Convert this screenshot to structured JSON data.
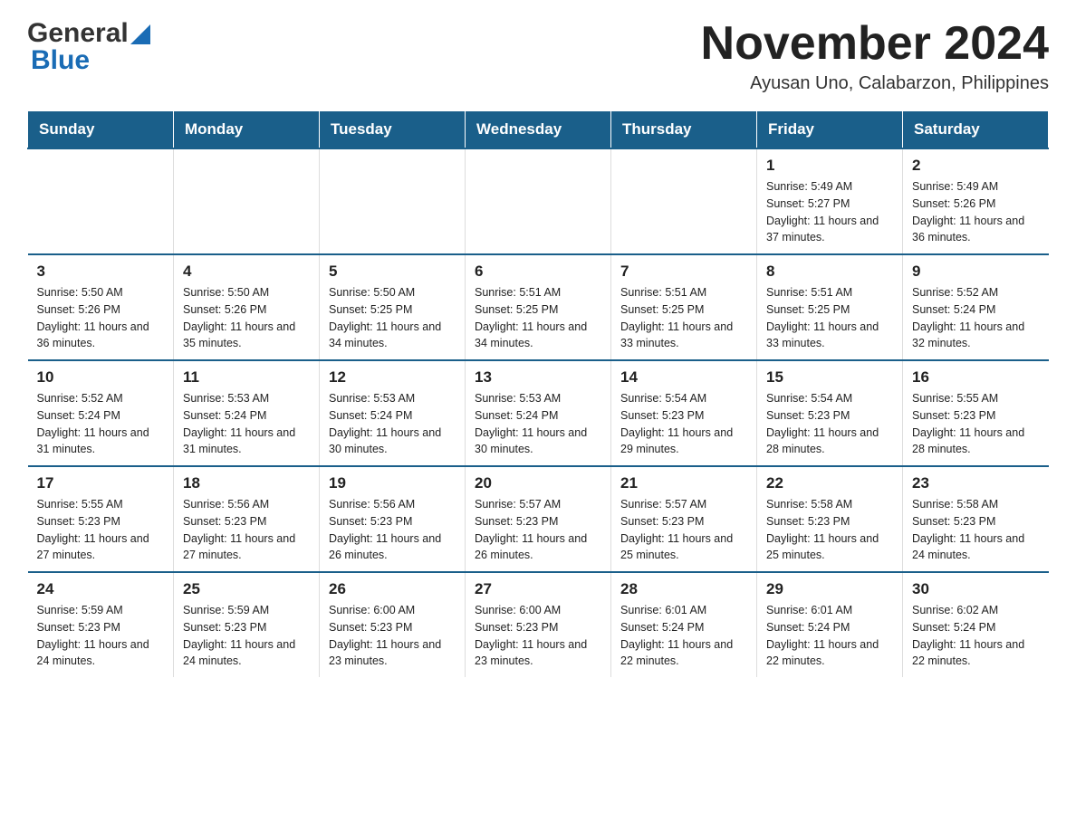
{
  "header": {
    "logo_general": "General",
    "logo_blue": "Blue",
    "main_title": "November 2024",
    "subtitle": "Ayusan Uno, Calabarzon, Philippines"
  },
  "calendar": {
    "days_of_week": [
      "Sunday",
      "Monday",
      "Tuesday",
      "Wednesday",
      "Thursday",
      "Friday",
      "Saturday"
    ],
    "weeks": [
      [
        {
          "day": "",
          "info": ""
        },
        {
          "day": "",
          "info": ""
        },
        {
          "day": "",
          "info": ""
        },
        {
          "day": "",
          "info": ""
        },
        {
          "day": "",
          "info": ""
        },
        {
          "day": "1",
          "info": "Sunrise: 5:49 AM\nSunset: 5:27 PM\nDaylight: 11 hours and 37 minutes."
        },
        {
          "day": "2",
          "info": "Sunrise: 5:49 AM\nSunset: 5:26 PM\nDaylight: 11 hours and 36 minutes."
        }
      ],
      [
        {
          "day": "3",
          "info": "Sunrise: 5:50 AM\nSunset: 5:26 PM\nDaylight: 11 hours and 36 minutes."
        },
        {
          "day": "4",
          "info": "Sunrise: 5:50 AM\nSunset: 5:26 PM\nDaylight: 11 hours and 35 minutes."
        },
        {
          "day": "5",
          "info": "Sunrise: 5:50 AM\nSunset: 5:25 PM\nDaylight: 11 hours and 34 minutes."
        },
        {
          "day": "6",
          "info": "Sunrise: 5:51 AM\nSunset: 5:25 PM\nDaylight: 11 hours and 34 minutes."
        },
        {
          "day": "7",
          "info": "Sunrise: 5:51 AM\nSunset: 5:25 PM\nDaylight: 11 hours and 33 minutes."
        },
        {
          "day": "8",
          "info": "Sunrise: 5:51 AM\nSunset: 5:25 PM\nDaylight: 11 hours and 33 minutes."
        },
        {
          "day": "9",
          "info": "Sunrise: 5:52 AM\nSunset: 5:24 PM\nDaylight: 11 hours and 32 minutes."
        }
      ],
      [
        {
          "day": "10",
          "info": "Sunrise: 5:52 AM\nSunset: 5:24 PM\nDaylight: 11 hours and 31 minutes."
        },
        {
          "day": "11",
          "info": "Sunrise: 5:53 AM\nSunset: 5:24 PM\nDaylight: 11 hours and 31 minutes."
        },
        {
          "day": "12",
          "info": "Sunrise: 5:53 AM\nSunset: 5:24 PM\nDaylight: 11 hours and 30 minutes."
        },
        {
          "day": "13",
          "info": "Sunrise: 5:53 AM\nSunset: 5:24 PM\nDaylight: 11 hours and 30 minutes."
        },
        {
          "day": "14",
          "info": "Sunrise: 5:54 AM\nSunset: 5:23 PM\nDaylight: 11 hours and 29 minutes."
        },
        {
          "day": "15",
          "info": "Sunrise: 5:54 AM\nSunset: 5:23 PM\nDaylight: 11 hours and 28 minutes."
        },
        {
          "day": "16",
          "info": "Sunrise: 5:55 AM\nSunset: 5:23 PM\nDaylight: 11 hours and 28 minutes."
        }
      ],
      [
        {
          "day": "17",
          "info": "Sunrise: 5:55 AM\nSunset: 5:23 PM\nDaylight: 11 hours and 27 minutes."
        },
        {
          "day": "18",
          "info": "Sunrise: 5:56 AM\nSunset: 5:23 PM\nDaylight: 11 hours and 27 minutes."
        },
        {
          "day": "19",
          "info": "Sunrise: 5:56 AM\nSunset: 5:23 PM\nDaylight: 11 hours and 26 minutes."
        },
        {
          "day": "20",
          "info": "Sunrise: 5:57 AM\nSunset: 5:23 PM\nDaylight: 11 hours and 26 minutes."
        },
        {
          "day": "21",
          "info": "Sunrise: 5:57 AM\nSunset: 5:23 PM\nDaylight: 11 hours and 25 minutes."
        },
        {
          "day": "22",
          "info": "Sunrise: 5:58 AM\nSunset: 5:23 PM\nDaylight: 11 hours and 25 minutes."
        },
        {
          "day": "23",
          "info": "Sunrise: 5:58 AM\nSunset: 5:23 PM\nDaylight: 11 hours and 24 minutes."
        }
      ],
      [
        {
          "day": "24",
          "info": "Sunrise: 5:59 AM\nSunset: 5:23 PM\nDaylight: 11 hours and 24 minutes."
        },
        {
          "day": "25",
          "info": "Sunrise: 5:59 AM\nSunset: 5:23 PM\nDaylight: 11 hours and 24 minutes."
        },
        {
          "day": "26",
          "info": "Sunrise: 6:00 AM\nSunset: 5:23 PM\nDaylight: 11 hours and 23 minutes."
        },
        {
          "day": "27",
          "info": "Sunrise: 6:00 AM\nSunset: 5:23 PM\nDaylight: 11 hours and 23 minutes."
        },
        {
          "day": "28",
          "info": "Sunrise: 6:01 AM\nSunset: 5:24 PM\nDaylight: 11 hours and 22 minutes."
        },
        {
          "day": "29",
          "info": "Sunrise: 6:01 AM\nSunset: 5:24 PM\nDaylight: 11 hours and 22 minutes."
        },
        {
          "day": "30",
          "info": "Sunrise: 6:02 AM\nSunset: 5:24 PM\nDaylight: 11 hours and 22 minutes."
        }
      ]
    ]
  }
}
